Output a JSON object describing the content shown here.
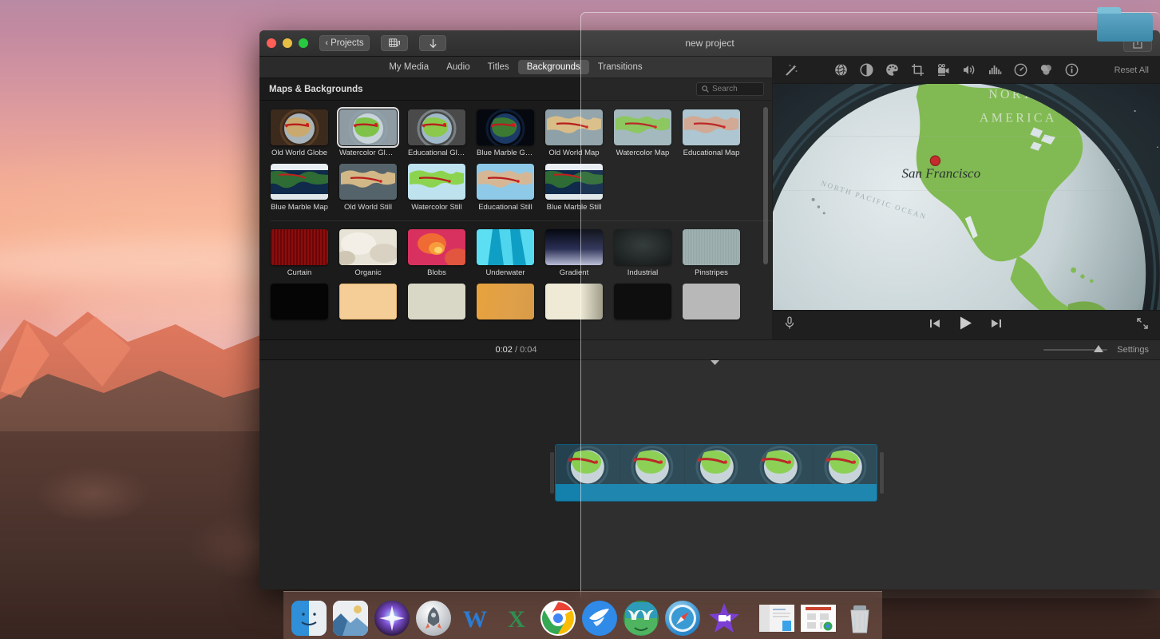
{
  "desktop": {
    "wallpaper_name": "macOS Sierra sunset mountains",
    "sky_top_color": "#b98aa4",
    "sky_bottom_color": "#f4ab8d",
    "rock_color": "#5a3d34"
  },
  "dock": {
    "items": [
      {
        "name": "finder",
        "label": "Finder",
        "color": "#3aa3e8",
        "glyph": "☺",
        "running": true
      },
      {
        "name": "photos",
        "label": "Photos",
        "color": "#dfe7ef",
        "glyph": "🏞",
        "running": true
      },
      {
        "name": "siri",
        "label": "Siri",
        "color": "#2b1e3c",
        "glyph": "✦",
        "running": false
      },
      {
        "name": "launchpad",
        "label": "Launchpad",
        "color": "#c9ccd1",
        "glyph": "🚀",
        "running": false
      },
      {
        "name": "microsoft-word",
        "label": "Microsoft Word",
        "color": "#2b7cd3",
        "glyph": "W",
        "running": false
      },
      {
        "name": "microsoft-excel",
        "label": "Microsoft Excel",
        "color": "#1d7044",
        "glyph": "X",
        "running": false
      },
      {
        "name": "google-chrome",
        "label": "Google Chrome",
        "color": "#ffffff",
        "glyph": "◎",
        "running": true
      },
      {
        "name": "dropbox-paper",
        "label": "Dropbox",
        "color": "#2f8ae8",
        "glyph": "✈",
        "running": true
      },
      {
        "name": "palm-app",
        "label": "Palm",
        "color": "#3f9f63",
        "glyph": "🌴",
        "running": true
      },
      {
        "name": "safari",
        "label": "Safari",
        "color": "#2a9ddd",
        "glyph": "🧭",
        "running": true
      },
      {
        "name": "imovie",
        "label": "iMovie",
        "color": "#7c3fd4",
        "glyph": "★",
        "running": true
      }
    ],
    "minimized": [
      {
        "name": "minimized-document-window",
        "label": "Document window"
      },
      {
        "name": "minimized-chrome-window",
        "label": "Chrome window"
      }
    ],
    "trash": {
      "name": "trash",
      "label": "Trash"
    }
  },
  "imovie": {
    "window_title": "new project",
    "titlebar": {
      "traffic_lights": [
        "close",
        "minimize",
        "zoom"
      ],
      "back_button_label": "Projects",
      "media_button_label": "media-music",
      "import_button_label": "import",
      "share_button_label": "share"
    },
    "tabs": [
      {
        "label": "My Media",
        "active": false
      },
      {
        "label": "Audio",
        "active": false
      },
      {
        "label": "Titles",
        "active": false
      },
      {
        "label": "Backgrounds",
        "active": true
      },
      {
        "label": "Transitions",
        "active": false
      }
    ],
    "browser": {
      "section_title": "Maps & Backgrounds",
      "search_placeholder": "Search",
      "search_value": "",
      "maps_row1": [
        {
          "label": "Old World Globe",
          "selected": false,
          "kind": "globe-oldworld"
        },
        {
          "label": "Watercolor Globe",
          "selected": true,
          "kind": "globe-watercolor"
        },
        {
          "label": "Educational Globe",
          "selected": false,
          "kind": "globe-educational"
        },
        {
          "label": "Blue Marble Globe",
          "selected": false,
          "kind": "globe-bluemarble"
        },
        {
          "label": "Old World Map",
          "selected": false,
          "kind": "map-oldworld"
        },
        {
          "label": "Watercolor Map",
          "selected": false,
          "kind": "map-watercolor"
        },
        {
          "label": "Educational Map",
          "selected": false,
          "kind": "map-educational"
        }
      ],
      "maps_row2": [
        {
          "label": "Blue Marble Map",
          "selected": false,
          "kind": "map-bluemarble"
        },
        {
          "label": "Old World Still",
          "selected": false,
          "kind": "still-oldworld"
        },
        {
          "label": "Watercolor Still",
          "selected": false,
          "kind": "still-watercolor"
        },
        {
          "label": "Educational Still",
          "selected": false,
          "kind": "still-educational"
        },
        {
          "label": "Blue Marble Still",
          "selected": false,
          "kind": "still-bluemarble"
        }
      ],
      "backgrounds_row1": [
        {
          "label": "Curtain",
          "kind": "bg-curtain"
        },
        {
          "label": "Organic",
          "kind": "bg-organic"
        },
        {
          "label": "Blobs",
          "kind": "bg-blobs"
        },
        {
          "label": "Underwater",
          "kind": "bg-underwater"
        },
        {
          "label": "Gradient",
          "kind": "bg-gradient"
        },
        {
          "label": "Industrial",
          "kind": "bg-industrial"
        },
        {
          "label": "Pinstripes",
          "kind": "bg-pinstripes"
        }
      ],
      "backgrounds_row2": [
        {
          "label": "",
          "kind": "bg-black"
        },
        {
          "label": "",
          "kind": "bg-peach"
        },
        {
          "label": "",
          "kind": "bg-linen"
        },
        {
          "label": "",
          "kind": "bg-gold"
        },
        {
          "label": "",
          "kind": "bg-cream"
        },
        {
          "label": "",
          "kind": "bg-darkblack"
        },
        {
          "label": "",
          "kind": "bg-gray"
        }
      ]
    },
    "viewer": {
      "reset_all_label": "Reset All",
      "adjust_icons": [
        {
          "name": "enhance-magic-wand-icon",
          "label": "Auto Enhance"
        },
        {
          "name": "globe-white-balance-icon",
          "label": "Balance Color"
        },
        {
          "name": "color-balance-icon",
          "label": "Color Balance"
        },
        {
          "name": "color-correction-palette-icon",
          "label": "Color Correction"
        },
        {
          "name": "crop-icon",
          "label": "Cropping"
        },
        {
          "name": "stabilization-camera-icon",
          "label": "Stabilization"
        },
        {
          "name": "volume-icon",
          "label": "Volume"
        },
        {
          "name": "noise-reduction-equalizer-icon",
          "label": "Noise Reduction"
        },
        {
          "name": "speed-icon",
          "label": "Speed"
        },
        {
          "name": "clip-filter-icon",
          "label": "Clip Filter"
        },
        {
          "name": "info-icon",
          "label": "Information"
        }
      ],
      "preview": {
        "continent_label_line1": "NORTH",
        "continent_label_line2": "AMERICA",
        "ocean_label": "NORTH PACIFIC OCEAN",
        "city_marker_label": "San Francisco",
        "marker_color": "#c42020",
        "land_color": "#7ab648",
        "ocean_color": "#c6d3d6"
      },
      "player": {
        "voiceover_label": "Record Voiceover",
        "skip_back_label": "Go to Beginning",
        "play_label": "Play",
        "skip_forward_label": "Go to End",
        "fullscreen_label": "Play Full Screen"
      }
    },
    "timeline": {
      "current_time": "0:02",
      "separator": "/",
      "total_time": "0:04",
      "settings_label": "Settings",
      "zoom_value": 78,
      "clip": {
        "name": "Watercolor Globe",
        "frame_count": 5,
        "audio_bar_color": "#1381ab",
        "selected": true
      },
      "music_dropzone_label": "music-note"
    }
  }
}
